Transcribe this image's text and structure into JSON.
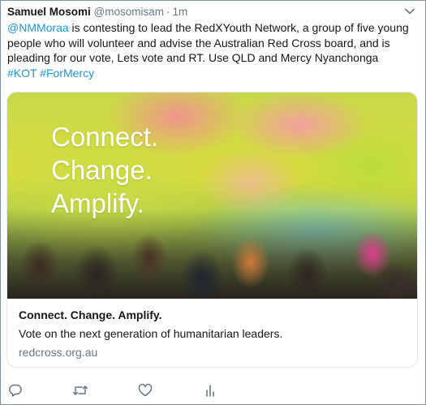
{
  "tweet": {
    "author_name": "Samuel Mosomi",
    "author_handle": "@mosomisam",
    "separator": "·",
    "time": "1m",
    "mention": "@NMMoraa",
    "body": " is contesting to lead the RedXYouth Network, a group of five young people who will volunteer and advise the Australian Red Cross board, and is pleading for our vote, Lets vote and RT. Use QLD and Mercy Nyanchonga",
    "hashtag_1": "#KOT",
    "hashtag_2": "#ForMercy"
  },
  "card": {
    "overlay_line_1": "Connect.",
    "overlay_line_2": "Change.",
    "overlay_line_3": "Amplify.",
    "title": "Connect. Change. Amplify.",
    "description": "Vote on the next generation of humanitarian leaders.",
    "domain": "redcross.org.au"
  },
  "icons": {
    "chevron": "chevron-down-icon",
    "reply": "reply-icon",
    "retweet": "retweet-icon",
    "like": "heart-icon",
    "analytics": "analytics-icon"
  },
  "colors": {
    "link": "#1b95e0",
    "secondary": "#657786",
    "icon": "#657786"
  }
}
